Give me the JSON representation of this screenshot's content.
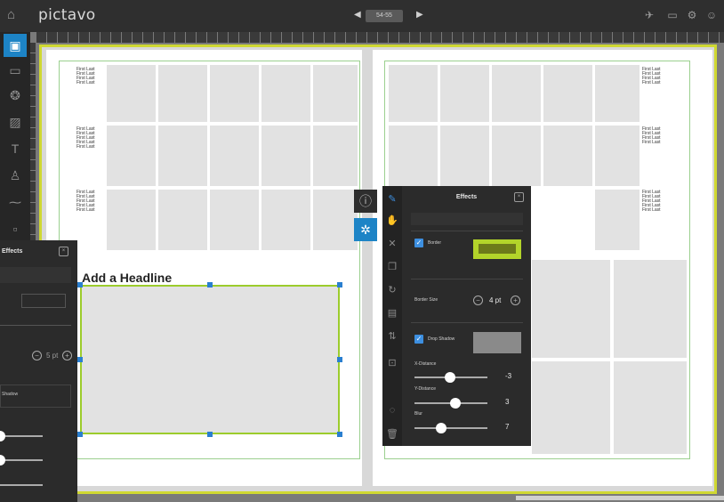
{
  "app": {
    "logo": "pictavo"
  },
  "nav": {
    "page_label": "54-55",
    "prev": "◀",
    "next": "▶"
  },
  "headline": "Add a Headline",
  "names": [
    "First Last",
    "First Last",
    "First Last",
    "First Last",
    "First Last"
  ],
  "effects_panel": {
    "title": "Effects",
    "border_label": "Border",
    "border_checked": true,
    "border_color_hex": "#b3d42a",
    "border_size_label": "Border Size",
    "border_size_value": "4 pt",
    "drop_shadow_label": "Drop Shadow",
    "drop_shadow_checked": true,
    "shadow_color_hex": "#8a8a8a",
    "x_distance_label": "X-Distance",
    "x_distance_value": "-3",
    "y_distance_label": "Y-Distance",
    "y_distance_value": "3",
    "blur_label": "Blur",
    "blur_value": "7"
  },
  "left_panel": {
    "title": "Effects",
    "border_size_value": "5 pt",
    "shadow_label": "Shadow"
  },
  "colors": {
    "accent": "#1d84c6",
    "topbar": "#2f2f2f",
    "panel": "#2b2b2b",
    "selection": "#9ccc2c",
    "book_outline": "#cfd832"
  }
}
